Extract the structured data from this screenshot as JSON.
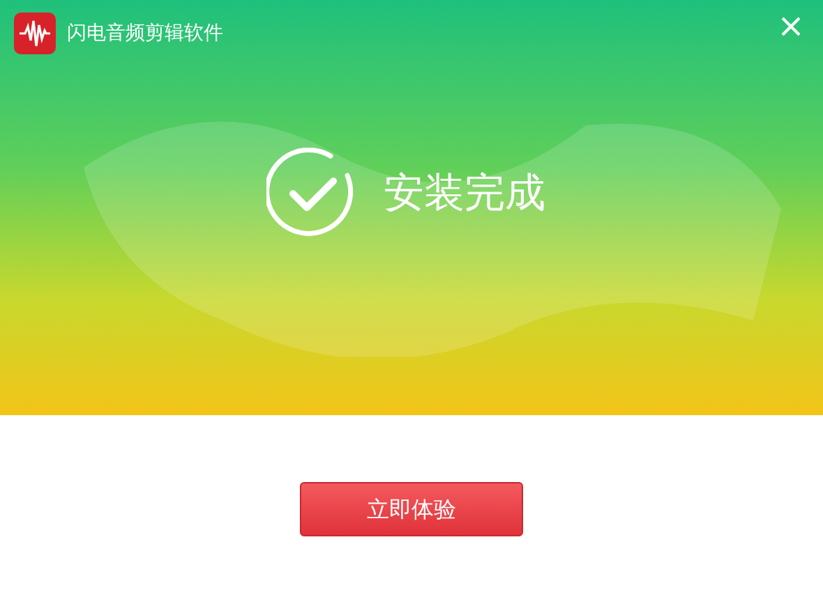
{
  "window": {
    "title": "闪电音频剪辑软件"
  },
  "status": {
    "message": "安装完成"
  },
  "buttons": [
    {
      "label": "立即体验"
    }
  ]
}
